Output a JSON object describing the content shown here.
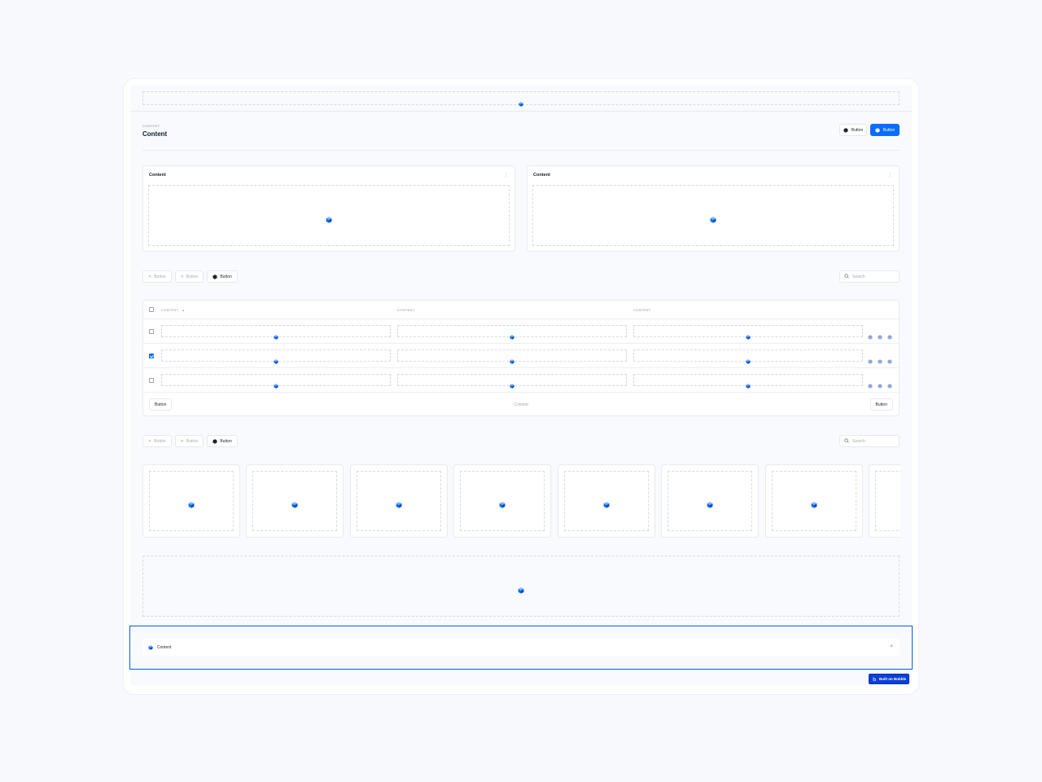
{
  "header": {
    "eyebrow": "CONTENT",
    "title": "Content",
    "secondary_button": "Button",
    "primary_button": "Button"
  },
  "cards": [
    {
      "title": "Content",
      "menu": "⋮"
    },
    {
      "title": "Content",
      "menu": "⋮"
    }
  ],
  "filters1": {
    "buttons": [
      "Button",
      "Button",
      "Button"
    ],
    "search_placeholder": "Search"
  },
  "table": {
    "headers": [
      "CONTENT",
      "CONTENT",
      "CONTENT"
    ],
    "sort_indicator": "▲",
    "rows": [
      {
        "checked": false
      },
      {
        "checked": true
      },
      {
        "checked": false
      }
    ],
    "footer": {
      "prev": "Button",
      "center": "Content",
      "next": "Button"
    }
  },
  "filters2": {
    "buttons": [
      "Button",
      "Button",
      "Button"
    ],
    "search_placeholder": "Search"
  },
  "gallery": {
    "visible_cards": 8
  },
  "toast": {
    "text": "Content",
    "close": "×"
  },
  "badge": {
    "text": "Built on Bubble"
  },
  "colors": {
    "accent": "#0b6cff",
    "badge": "#0a3fd9",
    "selection_outline": "#0b5de0",
    "page_bg": "#f7f9fc"
  },
  "icons": {
    "placeholder": "cube-icon",
    "search": "search-icon",
    "close": "close-icon",
    "menu": "kebab-icon",
    "bubble": "bubble-logo-icon"
  }
}
